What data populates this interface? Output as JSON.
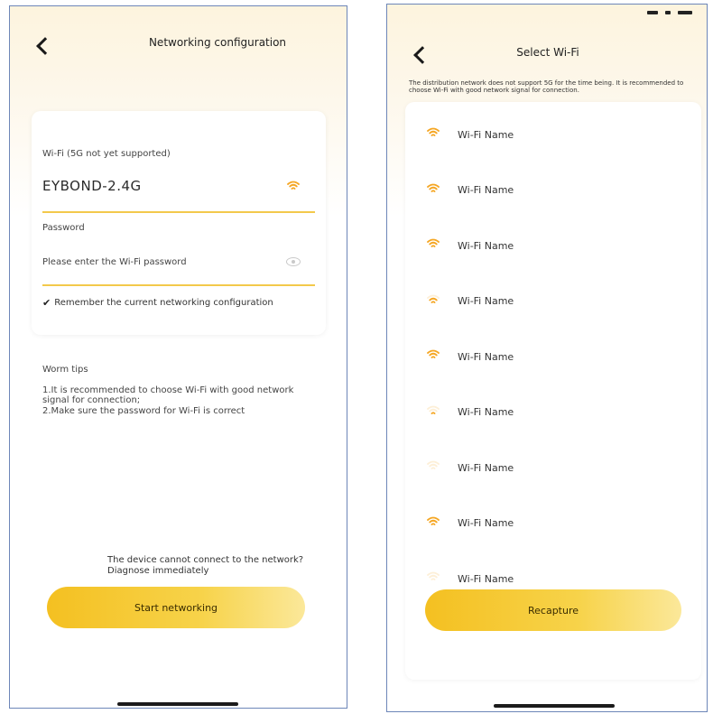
{
  "colors": {
    "accent": "#f5a623",
    "button_gradient_start": "#f4c021",
    "button_gradient_end": "#fbe89a",
    "underline": "#f3c94b"
  },
  "left_screen": {
    "back_icon": "chevron-left-icon",
    "title": "Networking configuration",
    "wifi_label": "Wi-Fi (5G not yet supported)",
    "wifi_value": "EYBOND-2.4G",
    "wifi_icon": "wifi-icon",
    "password_label": "Password",
    "password_placeholder": "Please enter the Wi-Fi password",
    "eye_icon": "eye-icon",
    "remember_label": "Remember the current networking configuration",
    "tips_title": "Worm tips",
    "tip_1": "1.It is recommended to choose Wi-Fi with good network signal for connection;",
    "tip_2": "2.Make sure the password for Wi-Fi is correct",
    "help_text": "The device cannot connect to the network? Diagnose immediately",
    "start_button": "Start networking"
  },
  "right_screen": {
    "back_icon": "chevron-left-icon",
    "title": "Select Wi-Fi",
    "notice": "The distribution network does not support 5G for the time being. It is recommended to choose Wi-Fi with good network signal for connection.",
    "wifi_list": [
      {
        "name": "Wi-Fi Name",
        "signal": 1.0
      },
      {
        "name": "Wi-Fi Name",
        "signal": 1.0
      },
      {
        "name": "Wi-Fi Name",
        "signal": 1.0
      },
      {
        "name": "Wi-Fi Name",
        "signal": 0.6
      },
      {
        "name": "Wi-Fi Name",
        "signal": 1.0
      },
      {
        "name": "Wi-Fi Name",
        "signal": 0.25
      },
      {
        "name": "Wi-Fi Name",
        "signal": 0.1
      },
      {
        "name": "Wi-Fi Name",
        "signal": 1.0
      },
      {
        "name": "Wi-Fi Name",
        "signal": 0.1
      }
    ],
    "recapture_button": "Recapture"
  }
}
